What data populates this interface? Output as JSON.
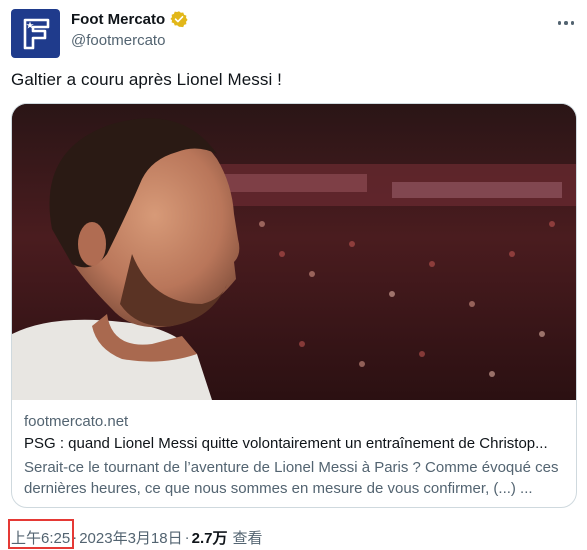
{
  "author": {
    "display_name": "Foot Mercato",
    "handle": "@footmercato",
    "avatar_icon": "foot-mercato-logo-icon",
    "verified_icon": "gold-verified-badge-icon",
    "avatar_color": "#1f3b8c",
    "verified_color": "#e2b719"
  },
  "tweet": {
    "text": "Galtier a couru après Lionel Messi !"
  },
  "card": {
    "image_icon": "player-photo-image",
    "domain": "footmercato.net",
    "title": "PSG : quand Lionel Messi quitte volontairement un entraînement de Christop...",
    "description": "Serait-ce le tournant de l’aventure de Lionel Messi à Paris ? Comme évoqué ces dernières heures, ce que nous sommes en mesure de vous confirmer, (...) ..."
  },
  "meta": {
    "time": "上午6:25",
    "separator": "·",
    "date": "2023年3月18日",
    "views_count": "2.7万",
    "views_label": "查看",
    "highlight_color": "#e53935"
  }
}
